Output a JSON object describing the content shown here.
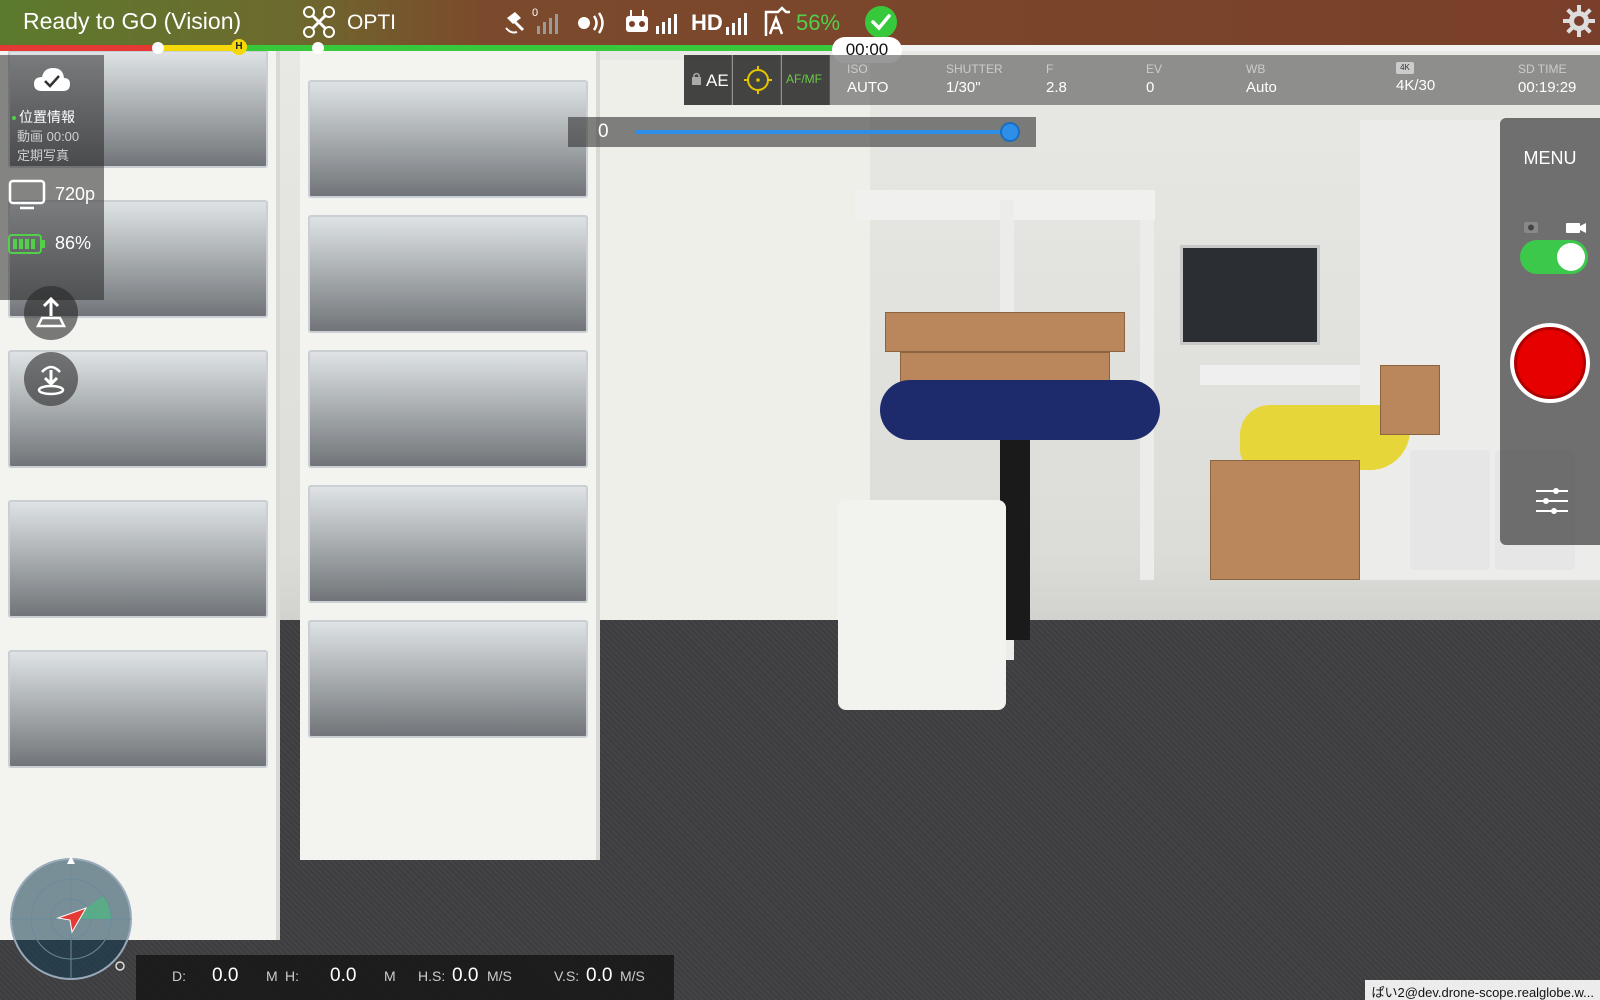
{
  "status": {
    "title": "Ready to GO (Vision)",
    "model": "OPTI",
    "satellite_count": "0",
    "hd_label": "HD",
    "battery": "56%",
    "home_marker": "H",
    "flight_time": "00:00",
    "colors": {
      "battery": "#52d04a",
      "ready": "#38c83c"
    }
  },
  "camera": {
    "ae_label": "AE",
    "afmf_label": "AF/MF",
    "params": [
      {
        "key": "ISO",
        "value": "AUTO"
      },
      {
        "key": "SHUTTER",
        "value": "1/30\""
      },
      {
        "key": "F",
        "value": "2.8"
      },
      {
        "key": "EV",
        "value": "0"
      },
      {
        "key": "WB",
        "value": "Auto"
      },
      {
        "key": "",
        "value": "4K/30",
        "icon": "resolution-icon",
        "icon_text": "4K"
      },
      {
        "key": "SD TIME",
        "value": "00:19:29"
      }
    ]
  },
  "exposure_slider": {
    "value": "0",
    "level": 1.0
  },
  "left_panel": {
    "location_label": "位置情報",
    "video_time": "動画 00:00",
    "interval_label": "定期写真",
    "transmission_res": "720p",
    "rc_battery": "86%"
  },
  "right_panel": {
    "menu_label": "MENU",
    "toggle_on": true
  },
  "telemetry": {
    "d_label": "D:",
    "d_value": "0.0",
    "d_unit": "M",
    "h_label": "H:",
    "h_value": "0.0",
    "h_unit": "M",
    "hs_label": "H.S:",
    "hs_value": "0.0",
    "hs_unit": "M/S",
    "vs_label": "V.S:",
    "vs_value": "0.0",
    "vs_unit": "M/S"
  },
  "footer_url": "ぱい2@dev.drone-scope.realglobe.w..."
}
